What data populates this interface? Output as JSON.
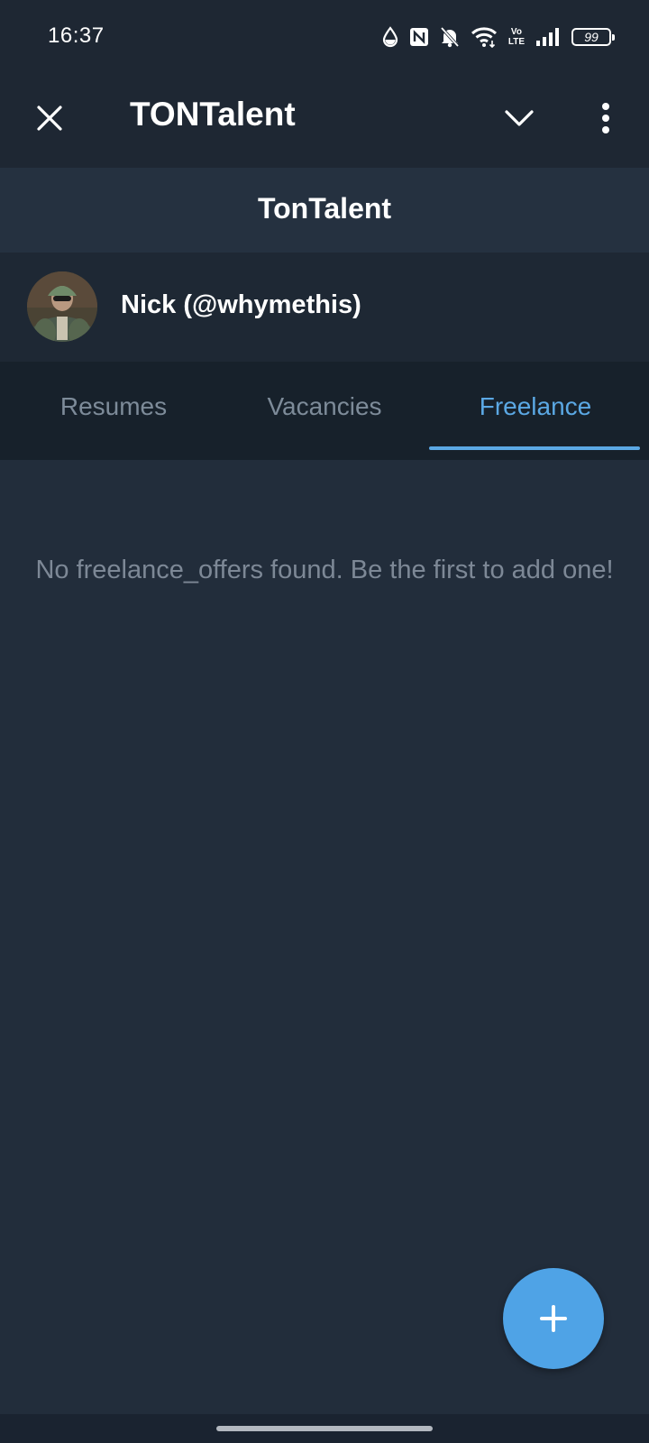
{
  "status_bar": {
    "time": "16:37",
    "battery": "99",
    "icons": [
      "water-drop-icon",
      "nfc-icon",
      "bell-off-icon",
      "wifi-icon",
      "volte-icon",
      "signal-icon",
      "battery-icon"
    ],
    "volte_top": "Vo",
    "volte_bottom": "LTE"
  },
  "top_bar": {
    "title": "TONTalent",
    "close_icon": "close-icon",
    "dropdown_icon": "chevron-down-icon",
    "menu_icon": "more-vertical-icon"
  },
  "app_header": {
    "title": "TonTalent"
  },
  "user": {
    "display": "Nick (@whymethis)"
  },
  "tabs": [
    {
      "label": "Resumes",
      "active": false
    },
    {
      "label": "Vacancies",
      "active": false
    },
    {
      "label": "Freelance",
      "active": true
    }
  ],
  "content": {
    "empty_message": "No freelance_offers found. Be the first to add one!"
  },
  "fab": {
    "icon": "plus-icon"
  },
  "colors": {
    "accent": "#5ba8e4",
    "fab": "#4fa3e6",
    "background": "#222d3b",
    "muted_text": "#7d8896"
  }
}
